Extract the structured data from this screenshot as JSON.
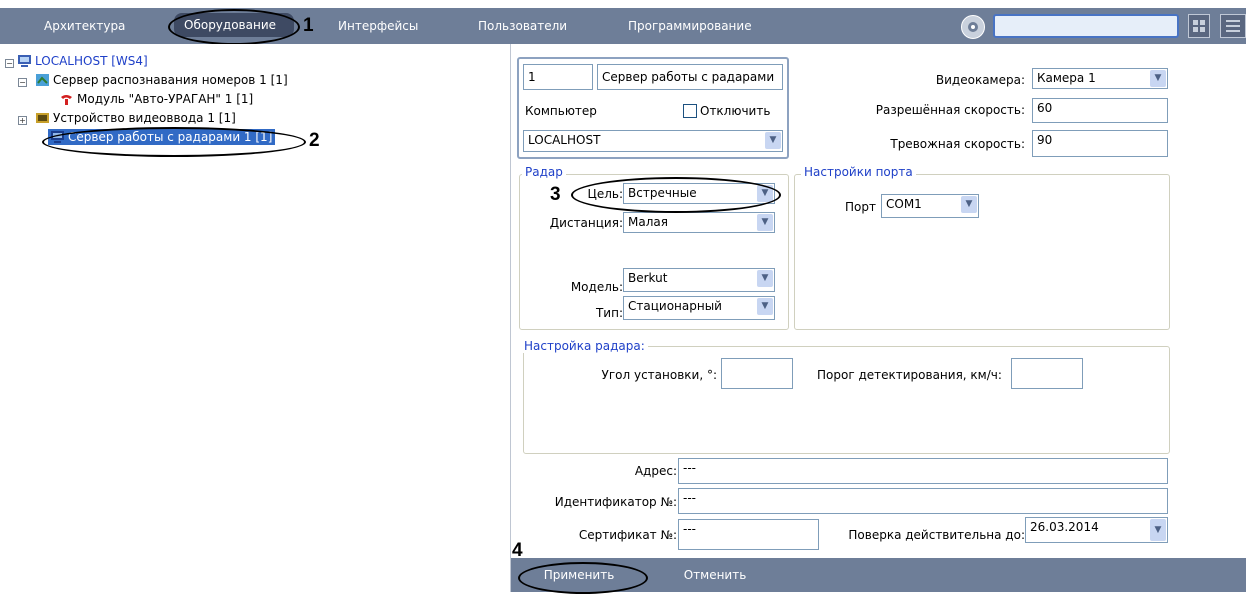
{
  "menu": {
    "items": [
      "Архитектура",
      "Оборудование",
      "Интерфейсы",
      "Пользователи",
      "Программирование"
    ],
    "active_index": 1
  },
  "callouts": [
    "1",
    "2",
    "3",
    "4"
  ],
  "tree": {
    "items": [
      {
        "label": "LOCALHOST [WS4]",
        "icon": "computer-icon"
      },
      {
        "label": "Сервер распознавания номеров 1 [1]",
        "icon": "plate-server-icon"
      },
      {
        "label": "Модуль \"Авто-УРАГАН\" 1 [1]",
        "icon": "module-icon"
      },
      {
        "label": "Устройство видеоввода 1 [1]",
        "icon": "video-device-icon"
      },
      {
        "label": "Сервер работы с радарами 1 [1]",
        "icon": "radar-server-icon",
        "selected": true
      }
    ]
  },
  "object": {
    "id": "1",
    "name": "Сервер работы с радарами",
    "computer_label": "Компьютер",
    "disable_label": "Отключить",
    "disabled": false,
    "computer": "LOCALHOST"
  },
  "camera": {
    "video_label": "Видеокамера:",
    "video_value": "Камера 1",
    "allowed_speed_label": "Разрешённая скорость:",
    "allowed_speed": "60",
    "alarm_speed_label": "Тревожная скорость:",
    "alarm_speed": "90"
  },
  "radar": {
    "group_title": "Радар",
    "target_label": "Цель:",
    "target_value": "Встречные",
    "distance_label": "Дистанция:",
    "distance_value": "Малая",
    "model_label": "Модель:",
    "model_value": "Berkut",
    "type_label": "Тип:",
    "type_value": "Стационарный"
  },
  "port": {
    "group_title": "Настройки порта",
    "port_label": "Порт",
    "port_value": "COM1"
  },
  "radar_setup": {
    "group_title": "Настройка радара:",
    "angle_label": "Угол установки, °:",
    "angle_value": "",
    "threshold_label": "Порог детектирования, км/ч:",
    "threshold_value": ""
  },
  "info": {
    "address_label": "Адрес:",
    "address_value": "---",
    "identifier_label": "Идентификатор №:",
    "identifier_value": "---",
    "certificate_label": "Сертификат №:",
    "certificate_value": "---",
    "verification_label": "Поверка действительна до:",
    "verification_value": "26.03.2014"
  },
  "buttons": {
    "apply": "Применить",
    "cancel": "Отменить"
  },
  "colors": {
    "menubar": "#6e7e98",
    "menu_active": "#3e4a63",
    "group_title": "#1f40c8",
    "tree_selected": "#316ac5",
    "tree_root": "#1f40c8"
  }
}
